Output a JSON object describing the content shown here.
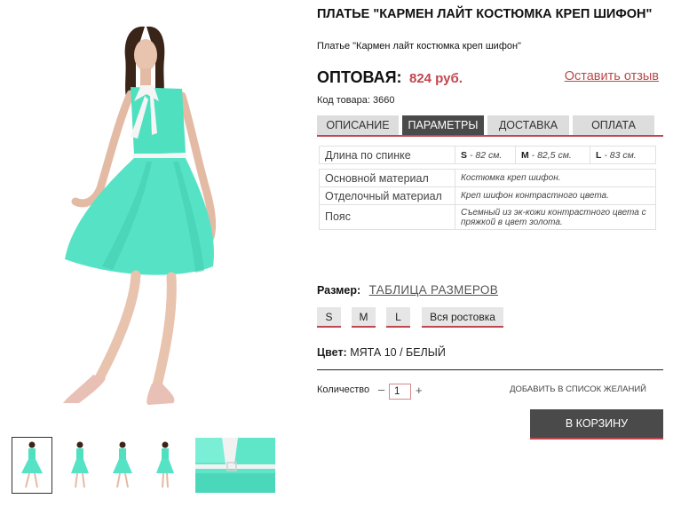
{
  "product": {
    "title": "ПЛАТЬЕ \"КАРМЕН ЛАЙТ КОСТЮМКА КРЕП ШИФОН\"",
    "subtitle": "Платье \"Кармен лайт костюмка креп шифон\"",
    "price_label": "ОПТОВАЯ:",
    "price_value": "824 руб.",
    "review_link": "Оставить отзыв",
    "sku_label": "Код товара:",
    "sku": "3660",
    "main_color": "#4fe0c0"
  },
  "tabs": [
    {
      "label": "ОПИСАНИЕ",
      "active": false
    },
    {
      "label": "ПАРАМЕТРЫ",
      "active": true
    },
    {
      "label": "ДОСТАВКА",
      "active": false
    },
    {
      "label": "ОПЛАТА",
      "active": false
    }
  ],
  "params": {
    "length_label": "Длина по спинке",
    "sizes": [
      {
        "size": "S",
        "value": "- 82 см."
      },
      {
        "size": "M",
        "value": "- 82,5 см."
      },
      {
        "size": "L",
        "value": "- 83 см."
      }
    ],
    "rows": [
      {
        "label": "Основной материал",
        "value": "Костюмка креп шифон."
      },
      {
        "label": "Отделочный материал",
        "value": "Креп шифон контрастного цвета."
      },
      {
        "label": "Пояс",
        "value": "Съемный из эк-кожи контрастного цвета с пряжкой в цвет золота."
      }
    ]
  },
  "size_section": {
    "label": "Размер:",
    "table_link": "ТАБЛИЦА РАЗМЕРОВ",
    "buttons": [
      "S",
      "M",
      "L",
      "Вся ростовка"
    ]
  },
  "color_section": {
    "label": "Цвет:",
    "value": "МЯТА 10 / БЕЛЫЙ"
  },
  "quantity": {
    "label": "Количество",
    "minus": "–",
    "value": "1",
    "plus": "+"
  },
  "wishlist": "ДОБАВИТЬ В СПИСОК ЖЕЛАНИЙ",
  "cart_button": "В КОРЗИНУ",
  "colors": {
    "accent": "#c2464f",
    "dark_button": "#4a4a4a",
    "tab_inactive": "#dddddd"
  }
}
